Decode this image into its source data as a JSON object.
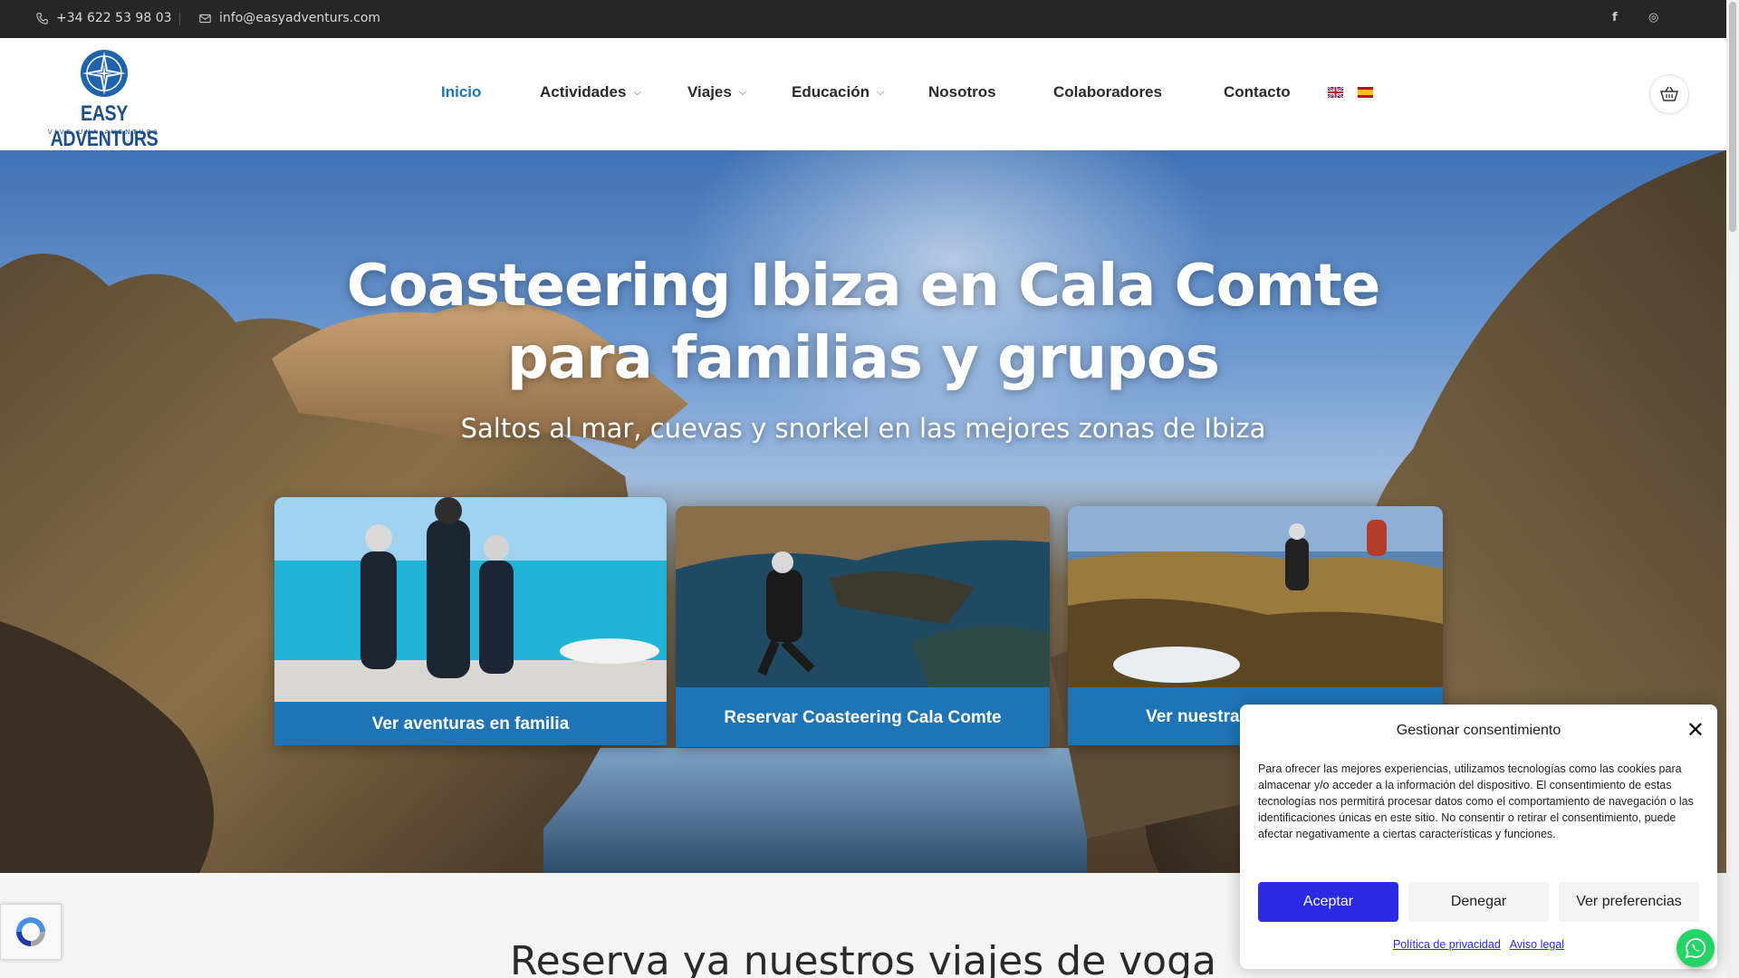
{
  "topbar": {
    "phone": "+34 622 53 98 03",
    "email": "info@easyadventurs.com",
    "social": [
      {
        "icon": "facebook-icon",
        "glyph": "f"
      },
      {
        "icon": "instagram-icon",
        "glyph": "◎"
      }
    ]
  },
  "header": {
    "logo_brand": "EASY ADVENTURS",
    "logo_tagline": "VIVE UNA AVENTURA",
    "nav": [
      {
        "label": "Inicio",
        "active": true,
        "dropdown": false
      },
      {
        "label": "Actividades",
        "active": false,
        "dropdown": true
      },
      {
        "label": "Viajes",
        "active": false,
        "dropdown": true
      },
      {
        "label": "Educación",
        "active": false,
        "dropdown": true
      },
      {
        "label": "Nosotros",
        "active": false,
        "dropdown": false
      },
      {
        "label": "Colaboradores",
        "active": false,
        "dropdown": false
      },
      {
        "label": "Contacto",
        "active": false,
        "dropdown": false
      }
    ],
    "languages": [
      "en-flag-icon",
      "es-flag-icon"
    ],
    "cart_icon": "basket-icon"
  },
  "hero": {
    "title": "Coasteering Ibiza en Cala Comte para familias y grupos",
    "subtitle": "Saltos al mar, cuevas y snorkel en las mejores zonas de Ibiza",
    "cards": [
      {
        "label": "Ver aventuras en familia"
      },
      {
        "label": "Reservar Coasteering Cala Comte"
      },
      {
        "label": "Ver nuestras rutas de coas"
      }
    ]
  },
  "section2": {
    "heading": "Reserva ya nuestros viajes de voga"
  },
  "cookie": {
    "title": "Gestionar consentimiento",
    "body": "Para ofrecer las mejores experiencias, utilizamos tecnologías como las cookies para almacenar y/o acceder a la información del dispositivo. El consentimiento de estas tecnologías nos permitirá procesar datos como el comportamiento de navegación o las identificaciones únicas en este sitio. No consentir o retirar el consentimiento, puede afectar negativamente a ciertas características y funciones.",
    "accept": "Aceptar",
    "deny": "Denegar",
    "prefs": "Ver preferencias",
    "privacy_link": "Política de privacidad",
    "legal_link": "Aviso legal"
  },
  "colors": {
    "accent": "#1f74b6",
    "cookie_accept": "#2b2be6",
    "topbar": "#262626",
    "whatsapp": "#25d366"
  }
}
